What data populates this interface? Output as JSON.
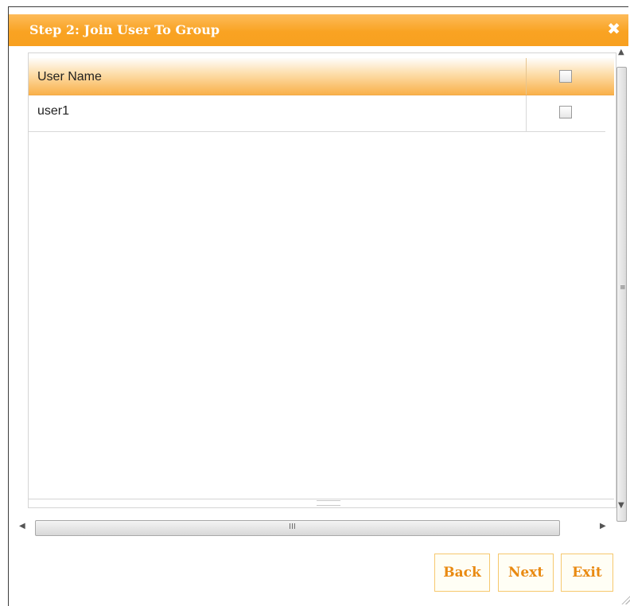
{
  "dialog": {
    "title": "Step 2: Join User To Group",
    "close_icon": "close-icon",
    "accent_color": "#f9a322"
  },
  "table": {
    "header": {
      "column": "User Name"
    },
    "rows": [
      {
        "name": "user1",
        "checked": false
      }
    ]
  },
  "scrollbar_glyphs": {
    "up": "▲",
    "down": "▼",
    "left": "◀",
    "right": "▶",
    "v_grip": "≡",
    "h_grip": "III"
  },
  "buttons": {
    "back": "Back",
    "next": "Next",
    "exit": "Exit"
  }
}
